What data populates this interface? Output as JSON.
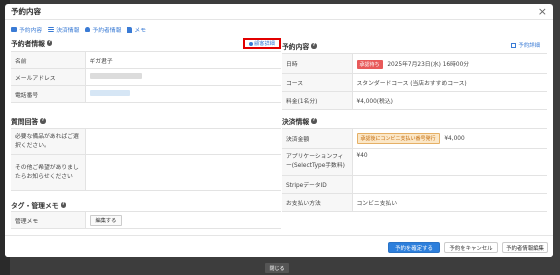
{
  "modal": {
    "title": "予約内容",
    "close_symbol": "×"
  },
  "toolbar": [
    {
      "label": "予約内容",
      "icon": "calendar-icon"
    },
    {
      "label": "決済情報",
      "icon": "card-icon"
    },
    {
      "label": "予約者情報",
      "icon": "person-icon"
    },
    {
      "label": "メモ",
      "icon": "doc-icon"
    }
  ],
  "reserver": {
    "title": "予約者情報",
    "customer_button": "顧客詳細",
    "rows": [
      {
        "k": "名前",
        "v": "ギガ君子"
      },
      {
        "k": "メールアドレス",
        "v": ""
      },
      {
        "k": "電話番号",
        "v": ""
      }
    ]
  },
  "questions": {
    "title": "質問回答",
    "rows": [
      {
        "k": "必要な備品があればご選択ください。",
        "v": ""
      },
      {
        "k": "その他ご希望がありましたらお知らせください",
        "v": ""
      }
    ]
  },
  "tags": {
    "title": "タグ・管理メモ",
    "memo_label": "管理メモ",
    "edit_label": "編集する"
  },
  "reservation": {
    "title": "予約内容",
    "detail_link": "予約詳細",
    "date_label": "日時",
    "date_badge": "承認待ち",
    "date_value": "2025年7月23日(水) 16時00分",
    "course_label": "コース",
    "course_value": "スタンダードコース (当店おすすめコース)",
    "fee_label": "料金(1名分)",
    "fee_value": "¥4,000(税込)"
  },
  "payment": {
    "title": "決済情報",
    "amount_label": "決済金額",
    "amount_badge": "承認後にコンビニ支払い番号発行",
    "amount_value": "¥4,000",
    "appfee_label": "アプリケーションフィー(SelectType手数料)",
    "appfee_value": "¥40",
    "stripe_label": "StripeデータID",
    "stripe_value": "",
    "method_label": "お支払い方法",
    "method_value": "コンビニ支払い"
  },
  "footer": {
    "confirm": "予約を確定する",
    "cancel": "予約をキャンセル",
    "edit": "予約者情報編集"
  },
  "page_close": "閉じる",
  "colors": {
    "accent": "#2d7fdc",
    "link": "#3a7bd5",
    "highlight_border": "#e20000",
    "pending_badge": "#e85a5a"
  }
}
